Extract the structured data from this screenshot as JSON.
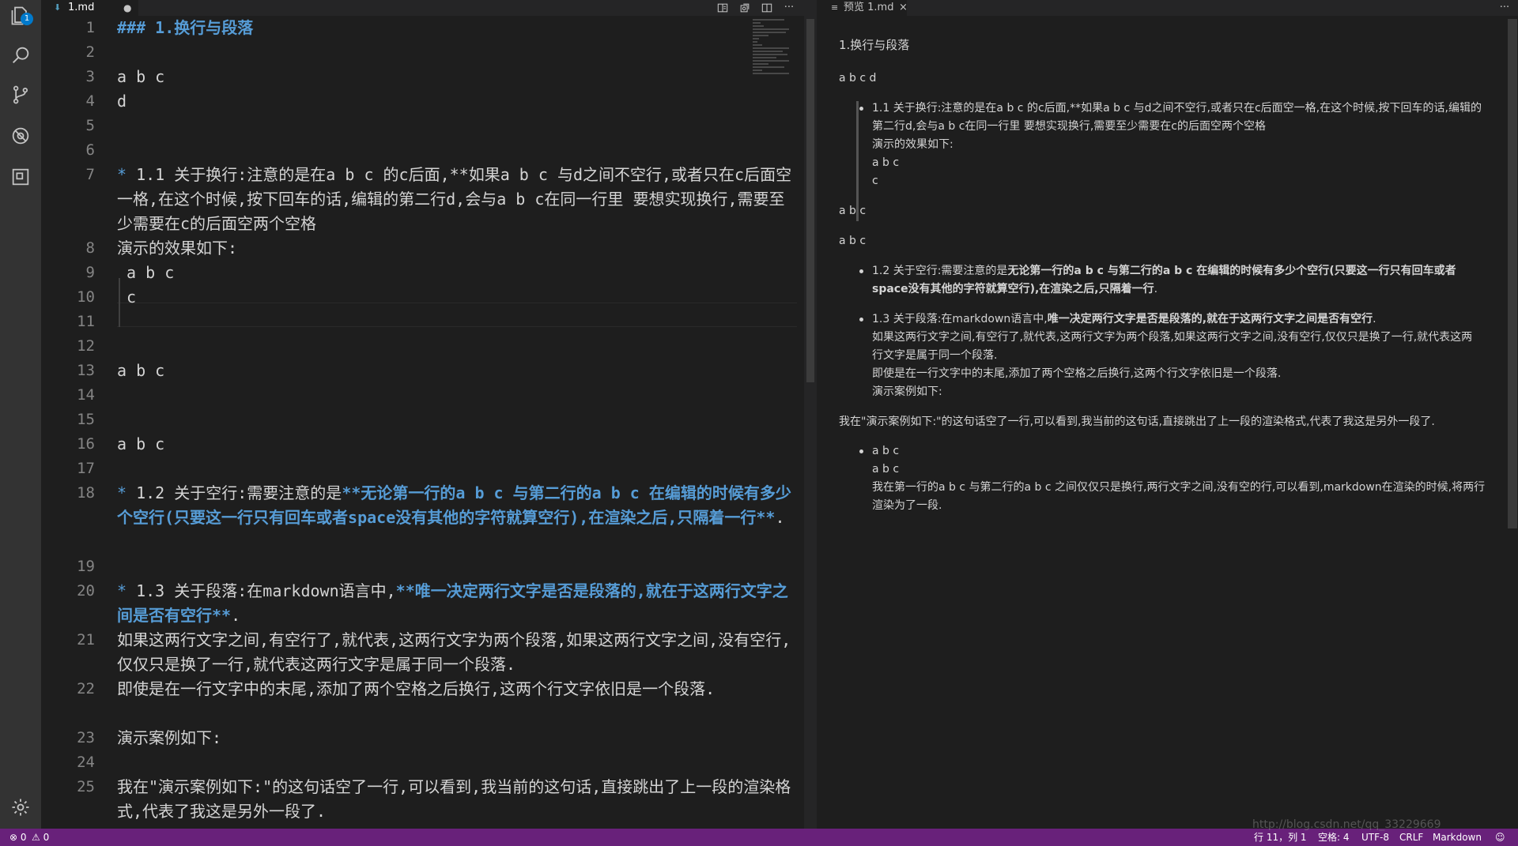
{
  "editor": {
    "tab_label": "1.md",
    "tab_modified": "●",
    "lines": [
      {
        "n": "1",
        "html": [
          {
            "t": "### 1.换行与段落",
            "c": "hd"
          }
        ]
      },
      {
        "n": "2",
        "html": []
      },
      {
        "n": "3",
        "html": [
          {
            "t": "a b c",
            "c": ""
          }
        ]
      },
      {
        "n": "4",
        "html": [
          {
            "t": "d",
            "c": ""
          }
        ]
      },
      {
        "n": "5",
        "html": []
      },
      {
        "n": "6",
        "html": []
      },
      {
        "n": "7",
        "html": [
          {
            "t": "* ",
            "c": "blue"
          },
          {
            "t": "1.1 关于换行:注意的是在a b c 的c后面,**如果a b c 与d之间不空行,或者只在c后面空一格,在这个时候,按下回车的话,编辑的第二行d,会与a b c在同一行里 要想实现换行,需要至少需要在c的后面空两个空格",
            "c": ""
          }
        ]
      },
      {
        "n": "8",
        "html": [
          {
            "t": "演示的效果如下:",
            "c": ""
          }
        ]
      },
      {
        "n": "9",
        "html": [
          {
            "t": " a b c",
            "c": ""
          }
        ]
      },
      {
        "n": "10",
        "html": [
          {
            "t": " c",
            "c": ""
          }
        ]
      },
      {
        "n": "11",
        "html": []
      },
      {
        "n": "12",
        "html": []
      },
      {
        "n": "13",
        "html": [
          {
            "t": "a b c",
            "c": ""
          }
        ]
      },
      {
        "n": "14",
        "html": []
      },
      {
        "n": "15",
        "html": []
      },
      {
        "n": "16",
        "html": [
          {
            "t": "a b c",
            "c": ""
          }
        ]
      },
      {
        "n": "17",
        "html": []
      },
      {
        "n": "18",
        "html": [
          {
            "t": "* ",
            "c": "blue"
          },
          {
            "t": "1.2 关于空行:需要注意的是",
            "c": ""
          },
          {
            "t": "**无论第一行的a b c 与第二行的a b c 在编辑的时候有多少个空行(只要这一行只有回车或者space没有其他的字符就算空行),在渲染之后,只隔着一行**",
            "c": "bold"
          },
          {
            "t": ".",
            "c": ""
          }
        ]
      },
      {
        "n": "19",
        "html": []
      },
      {
        "n": "20",
        "html": [
          {
            "t": "* ",
            "c": "blue"
          },
          {
            "t": "1.3 关于段落:在markdown语言中,",
            "c": ""
          },
          {
            "t": "**唯一决定两行文字是否是段落的,就在于这两行文字之间是否有空行**",
            "c": "bold"
          },
          {
            "t": ".",
            "c": ""
          }
        ]
      },
      {
        "n": "21",
        "html": [
          {
            "t": "如果这两行文字之间,有空行了,就代表,这两行文字为两个段落,如果这两行文字之间,没有空行,仅仅只是换了一行,就代表这两行文字是属于同一个段落.",
            "c": ""
          }
        ]
      },
      {
        "n": "22",
        "html": [
          {
            "t": "即使是在一行文字中的末尾,添加了两个空格之后换行,这两个行文字依旧是一个段落.",
            "c": ""
          }
        ]
      },
      {
        "n": "23",
        "html": [
          {
            "t": "演示案例如下:",
            "c": ""
          }
        ]
      },
      {
        "n": "24",
        "html": []
      },
      {
        "n": "25",
        "html": [
          {
            "t": "我在\"演示案例如下:\"的这句话空了一行,可以看到,我当前的这句话,直接跳出了上一段的渲染格式,代表了我这是另外一段了.",
            "c": ""
          }
        ]
      }
    ]
  },
  "preview": {
    "tab_label": "预览 1.md",
    "tab_close": "×",
    "heading": "1.换行与段落",
    "p_abcd": "a b c d",
    "li1_lines": [
      "1.1 关于换行:注意的是在a b c 的c后面,**如果a b c 与d之间不空行,或者只在c后面空一格,在这个时候,按下回车的话,编辑的",
      "第二行d,会与a b c在同一行里 要想实现换行,需要至少需要在c的后面空两个空格",
      "演示的效果如下:",
      "a b c",
      "c"
    ],
    "p_abc1": "a b c",
    "p_abc2": "a b c",
    "li2_prefix": "1.2 关于空行:需要注意的是",
    "li2_bold_1": "无论第一行的a b c 与第二行的a b c 在编辑的时候有多少个空行(只要这一行只有回车或者",
    "li2_bold_2": "space没有其他的字符就算空行),在渲染之后,只隔着一行",
    "li2_suffix": ".",
    "li3_prefix": "1.3 关于段落:在markdown语言中,",
    "li3_bold": "唯一决定两行文字是否是段落的,就在于这两行文字之间是否有空行",
    "li3_suffix": ".",
    "li3_lines": [
      "如果这两行文字之间,有空行了,就代表,这两行文字为两个段落,如果这两行文字之间,没有空行,仅仅只是换了一行,就代表这两",
      "行文字是属于同一个段落.",
      "即使是在一行文字中的末尾,添加了两个空格之后换行,这两个行文字依旧是一个段落.",
      "演示案例如下:"
    ],
    "p_demo": "我在\"演示案例如下:\"的这句话空了一行,可以看到,我当前的这句话,直接跳出了上一段的渲染格式,代表了我这是另外一段了.",
    "li4_lines": [
      "a b c",
      "a b c",
      "我在第一行的a b c 与第二行的a b c 之间仅仅只是换行,两行文字之间,没有空的行,可以看到,markdown在渲染的时候,将两行",
      "渲染为了一段."
    ]
  },
  "status": {
    "errors": "0",
    "warnings": "0",
    "position": "行 11，列 1",
    "indent": "空格: 4",
    "encoding": "UTF-8",
    "eol": "CRLF",
    "language": "Markdown"
  },
  "watermark": "http://blog.csdn.net/qq_33229669",
  "colors": {
    "accent": "#68217a",
    "badge": "#007acc",
    "keyword": "#569cd6"
  }
}
